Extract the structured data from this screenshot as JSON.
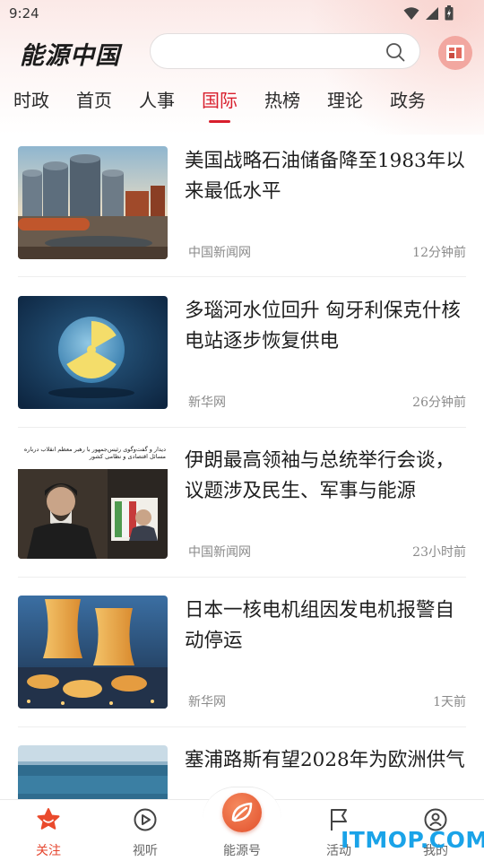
{
  "status_bar": {
    "time": "9:24"
  },
  "app": {
    "logo_text": "能源中国",
    "search_placeholder": ""
  },
  "tabs": [
    {
      "label": "时政",
      "active": false
    },
    {
      "label": "首页",
      "active": false
    },
    {
      "label": "人事",
      "active": false
    },
    {
      "label": "国际",
      "active": true
    },
    {
      "label": "热榜",
      "active": false
    },
    {
      "label": "理论",
      "active": false
    },
    {
      "label": "政务",
      "active": false
    }
  ],
  "news": [
    {
      "title": "美国战略石油储备降至1983年以来最低水平",
      "source": "中国新闻网",
      "time": "12分钟前",
      "thumb": "oil-tanks"
    },
    {
      "title": "多瑙河水位回升 匈牙利保克什核电站逐步恢复供电",
      "source": "新华网",
      "time": "26分钟前",
      "thumb": "radiation-symbol"
    },
    {
      "title": "伊朗最高领袖与总统举行会谈，议题涉及民生、军事与能源",
      "source": "中国新闻网",
      "time": "23小时前",
      "thumb": "iran-leaders",
      "thumb_caption": "دیدار و گفت‌وگوی رئیس‌جمهور با رهبر معظم انقلاب درباره مسائل اقتصادی و نظامی کشور"
    },
    {
      "title": "日本一核电机组因发电机报警自动停运",
      "source": "新华网",
      "time": "1天前",
      "thumb": "cooling-towers"
    },
    {
      "title": "塞浦路斯有望2028年为欧洲供气",
      "source": "",
      "time": "",
      "thumb": "sea"
    }
  ],
  "bottom_nav": [
    {
      "label": "关注",
      "icon": "follow-star-icon",
      "active": true
    },
    {
      "label": "视听",
      "icon": "play-icon",
      "active": false
    },
    {
      "label": "能源号",
      "icon": "leaf-icon",
      "active": false
    },
    {
      "label": "活动",
      "icon": "flag-icon",
      "active": false
    },
    {
      "label": "我的",
      "icon": "user-icon",
      "active": false
    }
  ],
  "watermark": "ITMOP.COM",
  "colors": {
    "accent": "#d81e2c",
    "nav_active": "#e5452e",
    "watermark": "#1aa3e8"
  }
}
